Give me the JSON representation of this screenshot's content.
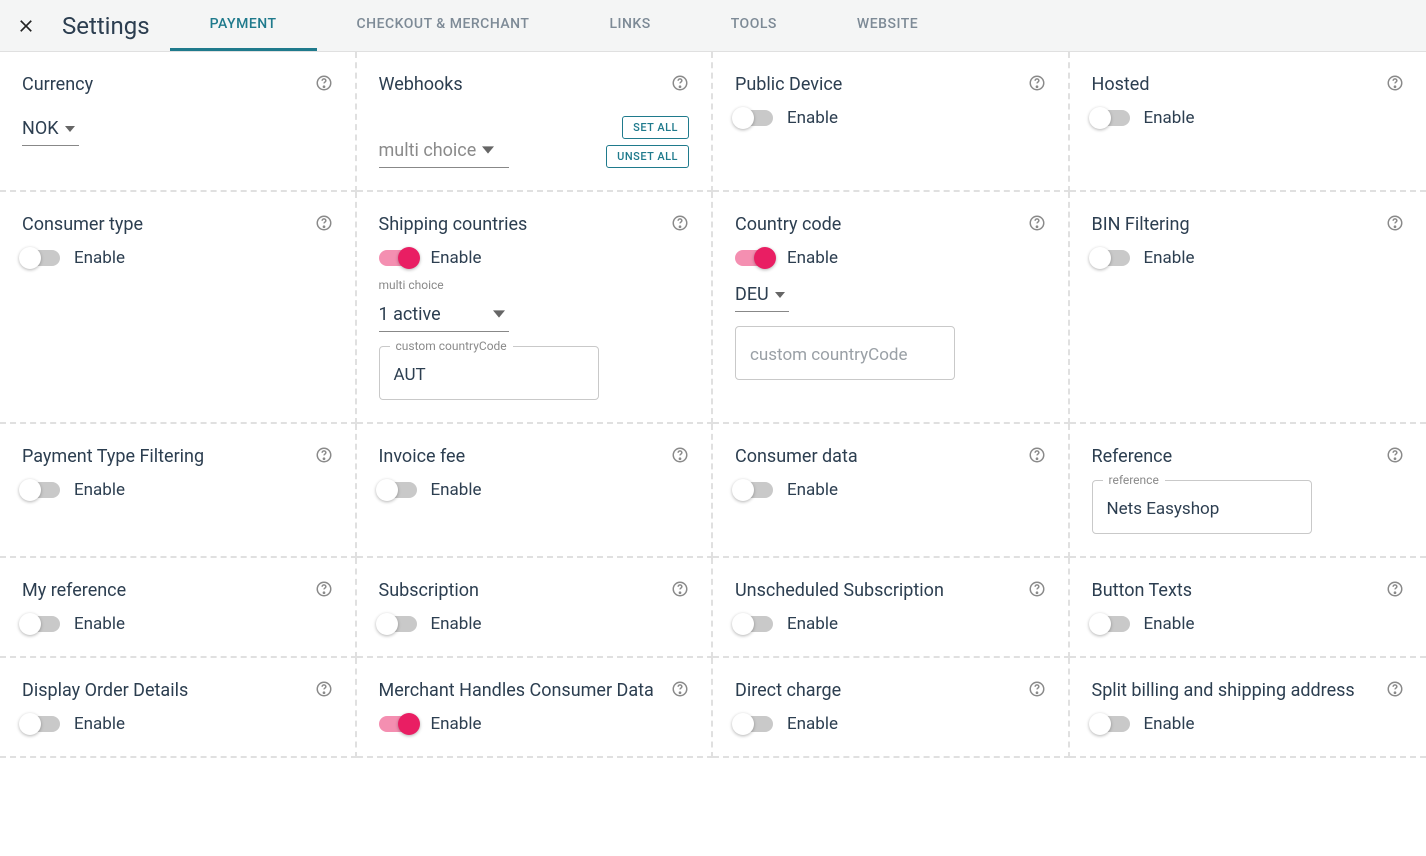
{
  "header": {
    "title": "Settings",
    "tabs": [
      "PAYMENT",
      "CHECKOUT & MERCHANT",
      "LINKS",
      "TOOLS",
      "WEBSITE"
    ],
    "active_tab": 0
  },
  "labels": {
    "enable": "Enable",
    "multi_choice": "multi choice",
    "custom_country_code": "custom countryCode",
    "reference": "reference"
  },
  "buttons": {
    "set_all": "SET ALL",
    "unset_all": "UNSET ALL"
  },
  "cards": {
    "currency": {
      "title": "Currency",
      "value": "NOK"
    },
    "webhooks": {
      "title": "Webhooks",
      "select": "multi choice"
    },
    "public_device": {
      "title": "Public Device",
      "enabled": false
    },
    "hosted": {
      "title": "Hosted",
      "enabled": false
    },
    "consumer_type": {
      "title": "Consumer type",
      "enabled": false
    },
    "shipping_countries": {
      "title": "Shipping countries",
      "enabled": true,
      "select": "1 active",
      "custom": "AUT"
    },
    "country_code": {
      "title": "Country code",
      "enabled": true,
      "value": "DEU",
      "placeholder": "custom countryCode"
    },
    "bin_filtering": {
      "title": "BIN Filtering",
      "enabled": false
    },
    "payment_type_filtering": {
      "title": "Payment Type Filtering",
      "enabled": false
    },
    "invoice_fee": {
      "title": "Invoice fee",
      "enabled": false
    },
    "consumer_data": {
      "title": "Consumer data",
      "enabled": false
    },
    "reference": {
      "title": "Reference",
      "value": "Nets Easyshop"
    },
    "my_reference": {
      "title": "My reference",
      "enabled": false
    },
    "subscription": {
      "title": "Subscription",
      "enabled": false
    },
    "unscheduled_subscription": {
      "title": "Unscheduled Subscription",
      "enabled": false
    },
    "button_texts": {
      "title": "Button Texts",
      "enabled": false
    },
    "display_order_details": {
      "title": "Display Order Details",
      "enabled": false
    },
    "merchant_handles_consumer_data": {
      "title": "Merchant Handles Consumer Data",
      "enabled": true
    },
    "direct_charge": {
      "title": "Direct charge",
      "enabled": false
    },
    "split_billing": {
      "title": "Split billing and shipping address",
      "enabled": false
    }
  }
}
